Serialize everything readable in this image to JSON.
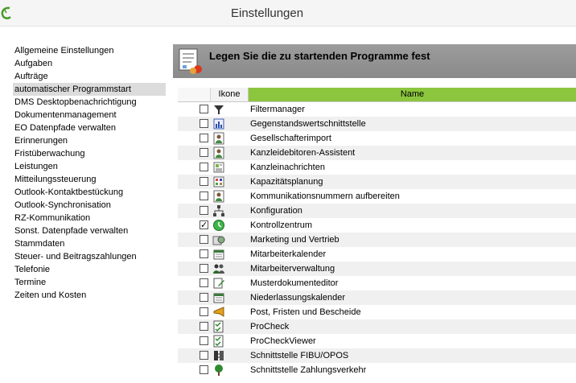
{
  "window": {
    "title": "Einstellungen"
  },
  "sidebar": {
    "selected_index": 3,
    "items": [
      "Allgemeine Einstellungen",
      "Aufgaben",
      "Aufträge",
      "automatischer Programmstart",
      "DMS Desktopbenachrichtigung",
      "Dokumentenmanagement",
      "EO Datenpfade verwalten",
      "Erinnerungen",
      "Fristüberwachung",
      "Leistungen",
      "Mitteilungssteuerung",
      "Outlook-Kontaktbestückung",
      "Outlook-Synchronisation",
      "RZ-Kommunikation",
      "Sonst. Datenpfade verwalten",
      "Stammdaten",
      "Steuer- und Beitragszahlungen",
      "Telefonie",
      "Termine",
      "Zeiten und Kosten"
    ]
  },
  "panel": {
    "title": "Legen Sie die zu startenden Programme fest"
  },
  "grid": {
    "columns": {
      "icon": "Ikone",
      "name": "Name"
    },
    "rows": [
      {
        "name": "Filtermanager",
        "checked": false,
        "icon": "funnel-icon"
      },
      {
        "name": "Gegenstandswertschnittstelle",
        "checked": false,
        "icon": "chart-icon"
      },
      {
        "name": "Gesellschafterimport",
        "checked": false,
        "icon": "person-icon"
      },
      {
        "name": "Kanzleidebitoren-Assistent",
        "checked": false,
        "icon": "person-icon"
      },
      {
        "name": "Kanzleinachrichten",
        "checked": false,
        "icon": "news-icon"
      },
      {
        "name": "Kapazitätsplanung",
        "checked": false,
        "icon": "grid-plan-icon"
      },
      {
        "name": "Kommunikationsnummern aufbereiten",
        "checked": false,
        "icon": "person-icon"
      },
      {
        "name": "Konfiguration",
        "checked": false,
        "icon": "network-icon"
      },
      {
        "name": "Kontrollzentrum",
        "checked": true,
        "icon": "clock-icon"
      },
      {
        "name": "Marketing und Vertrieb",
        "checked": false,
        "icon": "marketing-icon"
      },
      {
        "name": "Mitarbeiterkalender",
        "checked": false,
        "icon": "calendar-icon"
      },
      {
        "name": "Mitarbeiterverwaltung",
        "checked": false,
        "icon": "people-icon"
      },
      {
        "name": "Musterdokumenteditor",
        "checked": false,
        "icon": "document-edit-icon"
      },
      {
        "name": "Niederlassungskalender",
        "checked": false,
        "icon": "calendar-icon"
      },
      {
        "name": "Post, Fristen und Bescheide",
        "checked": false,
        "icon": "horn-icon"
      },
      {
        "name": "ProCheck",
        "checked": false,
        "icon": "checklist-icon"
      },
      {
        "name": "ProCheckViewer",
        "checked": false,
        "icon": "checklist-icon"
      },
      {
        "name": "Schnittstelle FIBU/OPOS",
        "checked": false,
        "icon": "interface-icon"
      },
      {
        "name": "Schnittstelle Zahlungsverkehr",
        "checked": false,
        "icon": "tree-icon"
      }
    ]
  },
  "colors": {
    "header_green": "#8cc63e",
    "panel_gray": "#939393",
    "selected_gray": "#dcdcdc"
  }
}
